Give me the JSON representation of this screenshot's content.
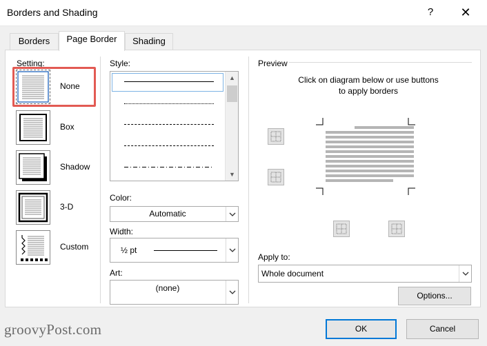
{
  "window": {
    "title": "Borders and Shading",
    "help": "?",
    "close": "✕"
  },
  "tabs": [
    {
      "label": "Borders"
    },
    {
      "label": "Page Border",
      "active": true
    },
    {
      "label": "Shading"
    }
  ],
  "setting": {
    "label": "Setting:",
    "items": [
      {
        "label": "None",
        "selected": true
      },
      {
        "label": "Box"
      },
      {
        "label": "Shadow"
      },
      {
        "label": "3-D"
      },
      {
        "label": "Custom"
      }
    ]
  },
  "style": {
    "label": "Style:",
    "options": [
      "solid",
      "dotted",
      "small-dashed",
      "dashed",
      "dash-dot"
    ],
    "selected_index": 0
  },
  "color": {
    "label": "Color:",
    "value": "Automatic"
  },
  "width": {
    "label": "Width:",
    "value": "½ pt"
  },
  "art": {
    "label": "Art:",
    "value": "(none)"
  },
  "preview": {
    "label": "Preview",
    "instruction_line1": "Click on diagram below or use buttons",
    "instruction_line2": "to apply borders"
  },
  "apply_to": {
    "label": "Apply to:",
    "value": "Whole document"
  },
  "buttons": {
    "options": "Options...",
    "ok": "OK",
    "cancel": "Cancel"
  },
  "watermark": "groovyPost.com",
  "colors": {
    "selection_outline": "#e25a53",
    "focus_blue": "#0078d7"
  }
}
